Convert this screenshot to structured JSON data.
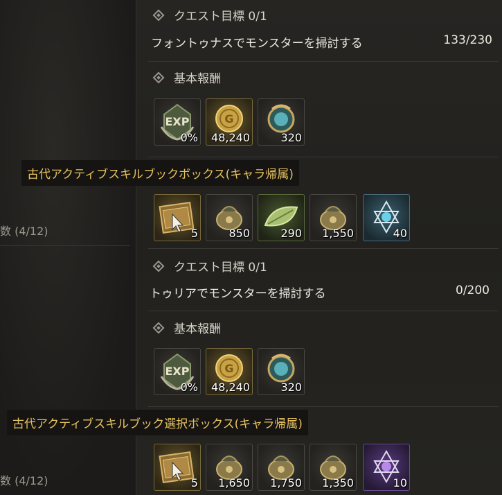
{
  "quest1": {
    "objective_header": "クエスト目標 0/1",
    "objective_text": "フォントゥナスでモンスターを掃討する",
    "objective_count": "133/230",
    "reward_header": "基本報酬",
    "basic_rewards": [
      {
        "icon": "exp-icon",
        "qty": "0%"
      },
      {
        "icon": "gold-coin-icon",
        "qty": "48,240"
      },
      {
        "icon": "blue-orb-icon",
        "qty": "320"
      }
    ],
    "tooltip": "古代アクティブスキルブックボックス(キャラ帰属)",
    "extra_rewards": [
      {
        "icon": "skill-book-box-icon",
        "qty": "5"
      },
      {
        "icon": "pouch-icon",
        "qty": "850"
      },
      {
        "icon": "green-leaf-icon",
        "qty": "290"
      },
      {
        "icon": "pouch-icon",
        "qty": "1,550"
      },
      {
        "icon": "hexagram-crystal-icon",
        "qty": "40"
      }
    ]
  },
  "quest2": {
    "objective_header": "クエスト目標 0/1",
    "objective_text": "トゥリアでモンスターを掃討する",
    "objective_count": "0/200",
    "reward_header": "基本報酬",
    "basic_rewards": [
      {
        "icon": "exp-icon",
        "qty": "0%"
      },
      {
        "icon": "gold-coin-icon",
        "qty": "48,240"
      },
      {
        "icon": "blue-orb-icon",
        "qty": "320"
      }
    ],
    "tooltip": "古代アクティブスキルブック選択ボックス(キャラ帰属)",
    "extra_rewards": [
      {
        "icon": "skill-book-box-icon",
        "qty": "5"
      },
      {
        "icon": "pouch-icon",
        "qty": "1,650"
      },
      {
        "icon": "pouch-icon",
        "qty": "1,750"
      },
      {
        "icon": "pouch-icon",
        "qty": "1,350"
      },
      {
        "icon": "purple-hexagram-crystal-icon",
        "qty": "10"
      }
    ]
  },
  "left_panel": {
    "count1": "数 (4/12)",
    "count2": "数 (4/12)"
  }
}
